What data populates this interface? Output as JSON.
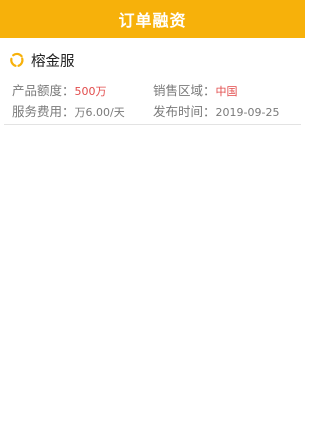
{
  "header": {
    "title": "订单融资"
  },
  "card": {
    "title": "榕金服",
    "icon": "brand-logo-icon",
    "accent_color": "#f7b10a",
    "fields": [
      {
        "label": "产品额度：",
        "value": "500万",
        "value_color": "#e24b4b"
      },
      {
        "label": "销售区域：",
        "value": "中国",
        "value_color": "#e24b4b"
      },
      {
        "label": "服务费用：",
        "value": "万6.00/天",
        "value_color": "#7a7a7a"
      },
      {
        "label": "发布时间：",
        "value": "2019-09-25",
        "value_color": "#7a7a7a"
      }
    ]
  }
}
